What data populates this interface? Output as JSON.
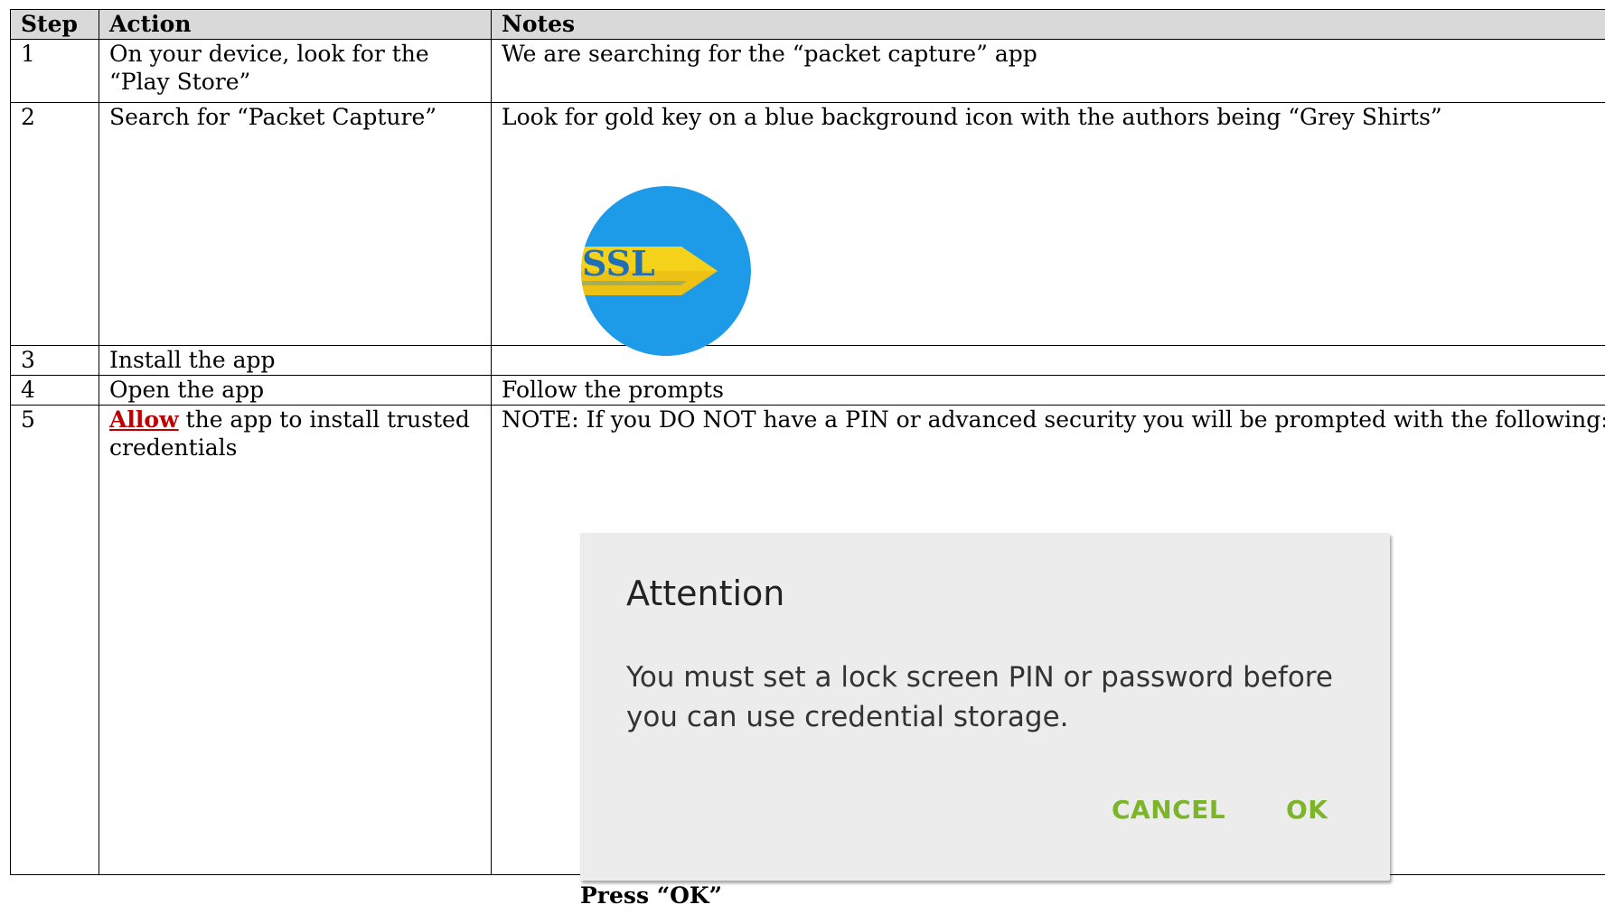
{
  "table": {
    "headers": [
      "Step",
      "Action",
      "Notes"
    ],
    "rows": [
      {
        "step": "1",
        "action": "On your device, look for the “Play Store”",
        "notes": "We are searching for the “packet capture” app"
      },
      {
        "step": "2",
        "action": "Search for “Packet Capture”",
        "notes": "Look for gold key on a blue background  icon with the authors being “Grey Shirts”"
      },
      {
        "step": "3",
        "action": "Install the app",
        "notes": ""
      },
      {
        "step": "4",
        "action": "Open the app",
        "notes": "Follow the prompts"
      },
      {
        "step": "5",
        "action_emphasis": "Allow",
        "action_rest": " the app to install trusted credentials",
        "notes": "NOTE: If you DO NOT have a PIN or advanced security you will be prompted with the following:"
      }
    ]
  },
  "app_icon": {
    "name": "ssl-key-icon",
    "text": "SSL",
    "bg_color": "#1e9be8",
    "key_color": "#f5d21a"
  },
  "dialog": {
    "title": "Attention",
    "message": "You must set a lock screen PIN or password before you can use credential storage.",
    "cancel_label": "CANCEL",
    "ok_label": "OK",
    "button_color": "#7cb52a"
  },
  "instruction": "Press “OK”"
}
